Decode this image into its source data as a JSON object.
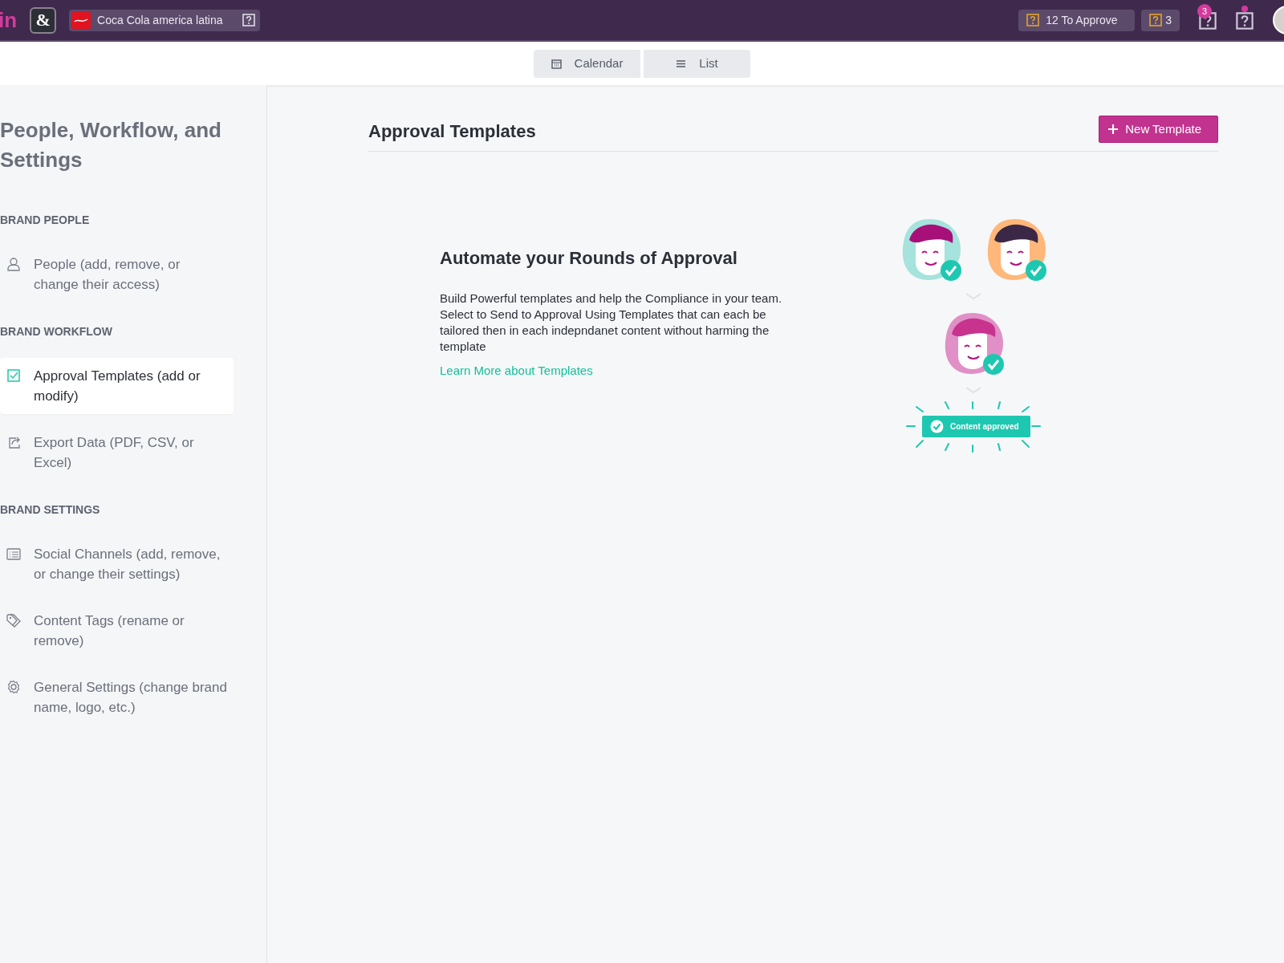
{
  "top_bar": {
    "logo": "in",
    "workspace_logo": "&",
    "brand": {
      "name": "Coca Cola america latina"
    },
    "approve_button": "12 To Approve",
    "count_button": "3",
    "alerts": [
      {
        "count": "3",
        "unread": false
      },
      {
        "unread": true
      }
    ]
  },
  "view_tabs": [
    {
      "label": "Calendar",
      "kind": "calendar",
      "selected": false
    },
    {
      "label": "List",
      "kind": "list",
      "selected": false
    }
  ],
  "sidebar": {
    "title": "People, Workflow, and Settings",
    "sections": [
      {
        "heading": "BRAND PEOPLE",
        "items": [
          {
            "label": "People (add, remove, or change their access)",
            "kind": "person",
            "selected": false
          }
        ]
      },
      {
        "heading": "BRAND WORKFLOW",
        "items": [
          {
            "label": "Approval Templates (add or modify)",
            "kind": "check",
            "selected": true
          },
          {
            "label": "Export Data (PDF, CSV, or Excel)",
            "kind": "export",
            "selected": false
          }
        ]
      },
      {
        "heading": "BRAND SETTINGS",
        "items": [
          {
            "label": "Social Channels (add, remove, or change their settings)",
            "kind": "list",
            "selected": false
          },
          {
            "label": "Content Tags (rename or remove)",
            "kind": "tag",
            "selected": false
          },
          {
            "label": "General Settings (change brand name, logo, etc.)",
            "kind": "gear",
            "selected": false
          }
        ]
      }
    ]
  },
  "main": {
    "title": "Approval Templates",
    "new_button": "New Template",
    "headline": "Automate your Rounds of Approval",
    "body": "Build Powerful templates and help the Compliance in your team. Select to Send to Approval Using Templates that can each be tailored then in each indepndanet content without harming the template",
    "link": "Learn More about Templates",
    "badge": "Content approved"
  }
}
